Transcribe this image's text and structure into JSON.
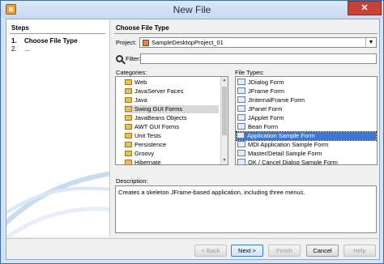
{
  "window": {
    "title": "New File",
    "close_label": "✕"
  },
  "steps": {
    "header": "Steps",
    "items": [
      {
        "num": "1.",
        "label": "Choose File Type"
      },
      {
        "num": "2.",
        "label": "..."
      }
    ]
  },
  "main": {
    "header": "Choose File Type",
    "project_label": "Project:",
    "project_value": "SampleDesktopProject_01",
    "filter_label": "Filter:",
    "filter_value": "",
    "categories_label": "Categories:",
    "categories": [
      "Web",
      "JavaServer Faces",
      "Java",
      "Swing GUI Forms",
      "JavaBeans Objects",
      "AWT GUI Forms",
      "Unit Tests",
      "Persistence",
      "Groovy",
      "Hibernate"
    ],
    "selected_category": "Swing GUI Forms",
    "file_types_label": "File Types:",
    "file_types": [
      "JDialog Form",
      "JFrame Form",
      "JInternalFrame Form",
      "JPanel Form",
      "JApplet Form",
      "Bean Form",
      "Application Sample Form",
      "MDI Application Sample Form",
      "Master/Detail Sample Form",
      "OK / Cancel Dialog Sample Form"
    ],
    "selected_file_type": "Application Sample Form",
    "description_label": "Description:",
    "description_text": "Creates a skeleton JFrame-based application, including three menus."
  },
  "buttons": {
    "back": "< Back",
    "next": "Next >",
    "finish": "Finish",
    "cancel": "Cancel",
    "help": "Help"
  }
}
